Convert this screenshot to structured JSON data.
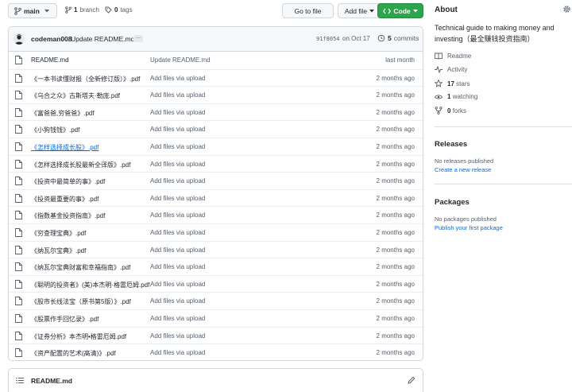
{
  "toolbar": {
    "branch": "main",
    "branches_count": "1",
    "branches_label": "branch",
    "tags_count": "0",
    "tags_label": "tags",
    "goto_file": "Go to file",
    "add_file": "Add file",
    "code": "Code"
  },
  "commit": {
    "author": "codeman008",
    "message": "Update README.md",
    "ellipsis": "...",
    "sha": "91f8054",
    "date": "on Oct 17",
    "count": "5",
    "count_label": "commits"
  },
  "files": [
    {
      "name": "README.md",
      "commit": "Update README.md",
      "date": "last month",
      "link": false
    },
    {
      "name": "《一本书读懂财报（全新修订版）》.pdf",
      "commit": "Add files via upload",
      "date": "2 months ago",
      "link": false
    },
    {
      "name": "《乌合之众》古斯塔夫·勒庞.pdf",
      "commit": "Add files via upload",
      "date": "2 months ago",
      "link": false
    },
    {
      "name": "《富爸爸,穷爸爸》.pdf",
      "commit": "Add files via upload",
      "date": "2 months ago",
      "link": false
    },
    {
      "name": "《小狗钱钱》.pdf",
      "commit": "Add files via upload",
      "date": "2 months ago",
      "link": false
    },
    {
      "name": "《怎样选择成长股》.pdf",
      "commit": "Add files via upload",
      "date": "2 months ago",
      "link": true
    },
    {
      "name": "《怎样选择成长股最新全译版》.pdf",
      "commit": "Add files via upload",
      "date": "2 months ago",
      "link": false
    },
    {
      "name": "《投资中最简单的事》.pdf",
      "commit": "Add files via upload",
      "date": "2 months ago",
      "link": false
    },
    {
      "name": "《投资最重要的事》.pdf",
      "commit": "Add files via upload",
      "date": "2 months ago",
      "link": false
    },
    {
      "name": "《指数基金投资指南》.pdf",
      "commit": "Add files via upload",
      "date": "2 months ago",
      "link": false
    },
    {
      "name": "《穷查理宝典》.pdf",
      "commit": "Add files via upload",
      "date": "2 months ago",
      "link": false
    },
    {
      "name": "《纳瓦尔宝典》.pdf",
      "commit": "Add files via upload",
      "date": "2 months ago",
      "link": false
    },
    {
      "name": "《纳瓦尔宝典财富和幸福指南》.pdf",
      "commit": "Add files via upload",
      "date": "2 months ago",
      "link": false
    },
    {
      "name": "《聪明的投资者》(美)本杰明·格雷厄姆.pdf",
      "commit": "Add files via upload",
      "date": "2 months ago",
      "link": false
    },
    {
      "name": "《股市长线法宝（原书第5版）》.pdf",
      "commit": "Add files via upload",
      "date": "2 months ago",
      "link": false
    },
    {
      "name": "《股票作手回忆录》.pdf",
      "commit": "Add files via upload",
      "date": "2 months ago",
      "link": false
    },
    {
      "name": "《证券分析》本杰明•格雷厄姆.pdf",
      "commit": "Add files via upload",
      "date": "2 months ago",
      "link": false
    },
    {
      "name": "《资产配置的艺术(高清)》.pdf",
      "commit": "Add files via upload",
      "date": "2 months ago",
      "link": false
    }
  ],
  "readme": {
    "title": "README.md"
  },
  "sidebar": {
    "about": "About",
    "description": "Technical guide to making money and investing（最全赚钱投资指南）",
    "readme": "Readme",
    "activity": "Activity",
    "stars_count": "17",
    "stars_label": "stars",
    "watching_count": "1",
    "watching_label": "watching",
    "forks_count": "0",
    "forks_label": "forks",
    "releases_title": "Releases",
    "releases_empty": "No releases published",
    "releases_link": "Create a new release",
    "packages_title": "Packages",
    "packages_empty": "No packages published",
    "packages_link": "Publish your first package"
  },
  "colors": {
    "accent": "#0969da",
    "code_button": "#2da44e",
    "border": "#d0d7de"
  }
}
